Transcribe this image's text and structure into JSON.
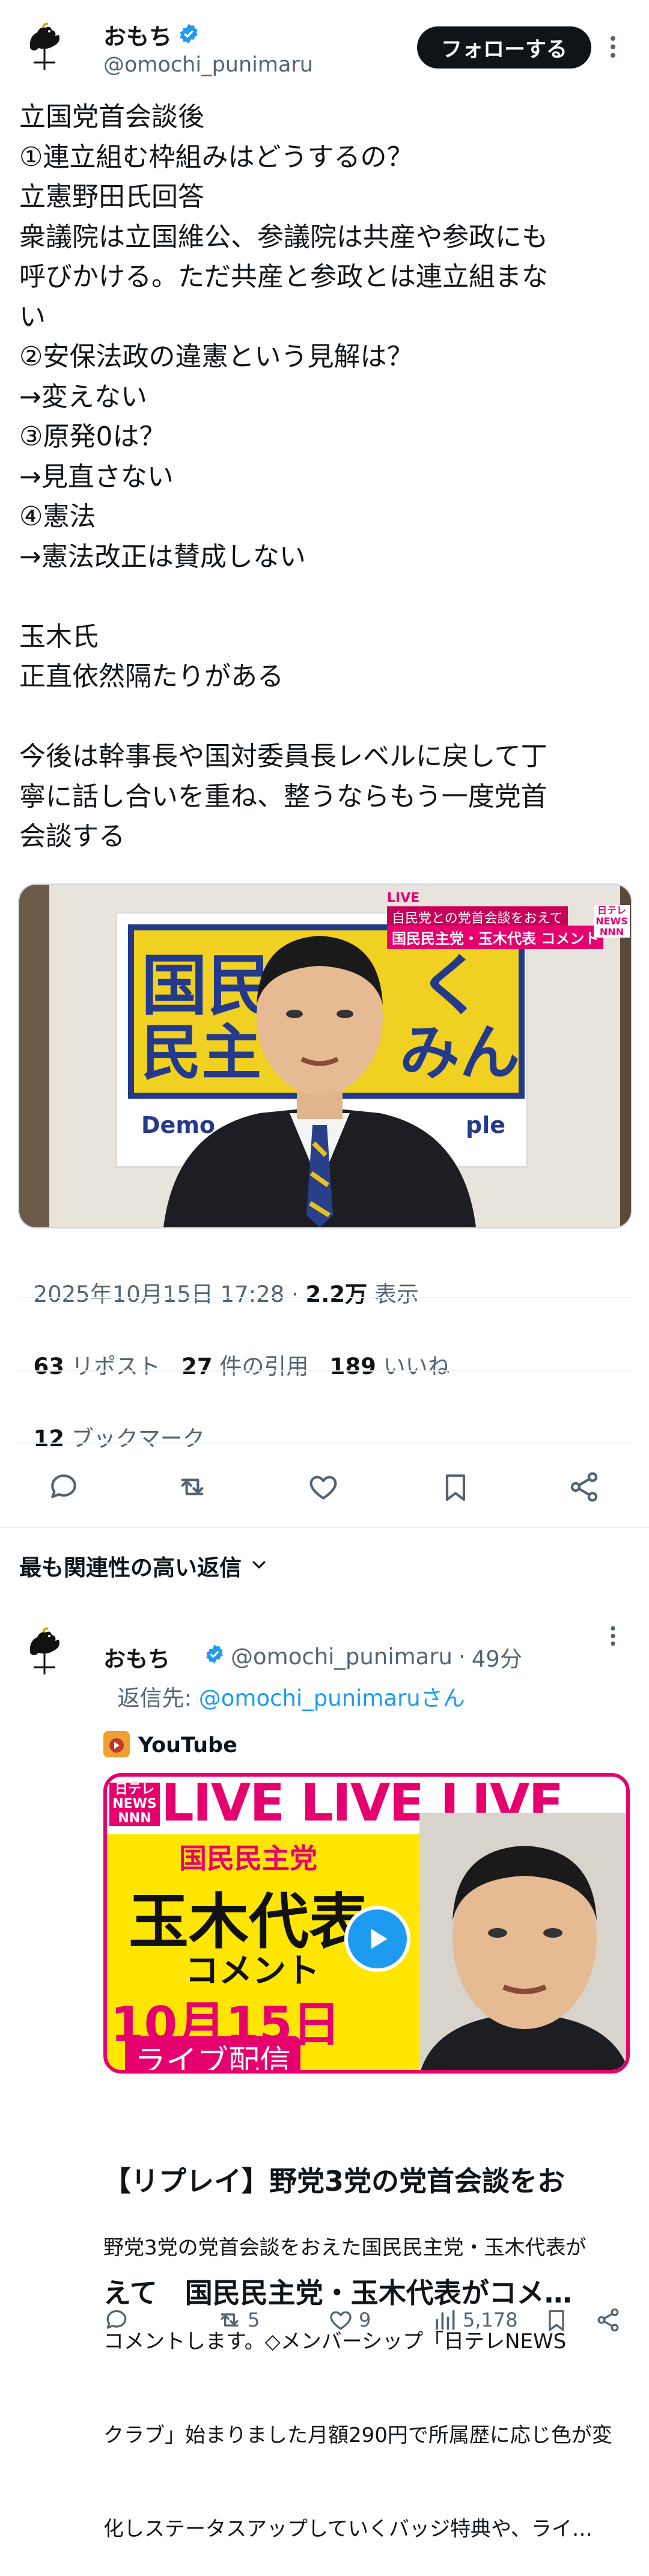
{
  "author": {
    "name": "おもち",
    "handle": "@omochi_punimaru",
    "follow_label": "フォローする",
    "verified_color": "#1d9bf0"
  },
  "tweet": {
    "lines": [
      "立国党首会談後",
      "①連立組む枠組みはどうするの？",
      "立憲野田氏回答",
      "衆議院は立国維公、参議院は共産や参政にも",
      "呼びかける。ただ共産と参政とは連立組まな",
      "い",
      "②安保法政の違憲という見解は？",
      "→変えない",
      "③原発0は？",
      "→見直さない",
      "④憲法",
      "→憲法改正は賛成しない",
      "",
      "玉木氏",
      "正直依然隔たりがある",
      "",
      "今後は幹事長や国対委員長レベルに戻して丁",
      "寧に話し合いを重ね、整うならもう一度党首",
      "会談する"
    ],
    "media": {
      "live_label": "LIVE",
      "caption_1": "自民党との党首会談をおえて",
      "caption_2": "国民民主党・玉木代表 コメント",
      "network_label": "日テレ NEWS NNN",
      "board_line_1": "国民",
      "board_line_1b": "く",
      "board_line_2": "民主",
      "board_line_2b": "みん",
      "board_en_left": "Demo",
      "board_en_right": "ple"
    },
    "date": "2025年10月15日 17:28",
    "views_count": "2.2万",
    "views_label": "表示"
  },
  "stats": {
    "reposts_count": "63",
    "reposts_label": "リポスト",
    "quotes_count": "27",
    "quotes_label": "件の引用",
    "likes_count": "189",
    "likes_label": "いいね",
    "bookmarks_count": "12",
    "bookmarks_label": "ブックマーク"
  },
  "replies_sort": {
    "label": "最も関連性の高い返信"
  },
  "reply": {
    "name": "おもち",
    "handle": "@omochi_punimaru",
    "time": "49分",
    "separator": "·",
    "reply_to_prefix": "返信先: ",
    "reply_to_handle": "@omochi_punimaruさん",
    "card": {
      "source": "YouTube",
      "thumb": {
        "live_text": "LIVE LIVE LIVE",
        "party": "国民民主党",
        "leader": "玉木代表",
        "comment": "コメント",
        "date": "10月15日",
        "stream": "ライブ配信",
        "network": "日テレ NEWS NNN"
      },
      "title_line_1": "【リプレイ】野党3党の党首会談をお",
      "title_line_2": "えて　国民民主党・玉木代表がコメ…",
      "desc_line_1": "野党3党の党首会談をおえた国民民主党・玉木代表が",
      "desc_line_2": "コメントします。◇メンバーシップ「日テレNEWS",
      "desc_line_3": "クラブ」始まりました月額290円で所属歴に応じ色が変",
      "desc_line_4": "化しステータスアップしていくバッジ特典や、ライ…"
    },
    "actions": {
      "reposts": "5",
      "likes": "9",
      "views": "5,178"
    }
  },
  "colors": {
    "accent": "#1d9bf0",
    "text": "#0f1419",
    "muted": "#536471",
    "divider": "#eff3f4",
    "live_pink": "#e6006e",
    "thumb_yellow": "#ffe600"
  }
}
